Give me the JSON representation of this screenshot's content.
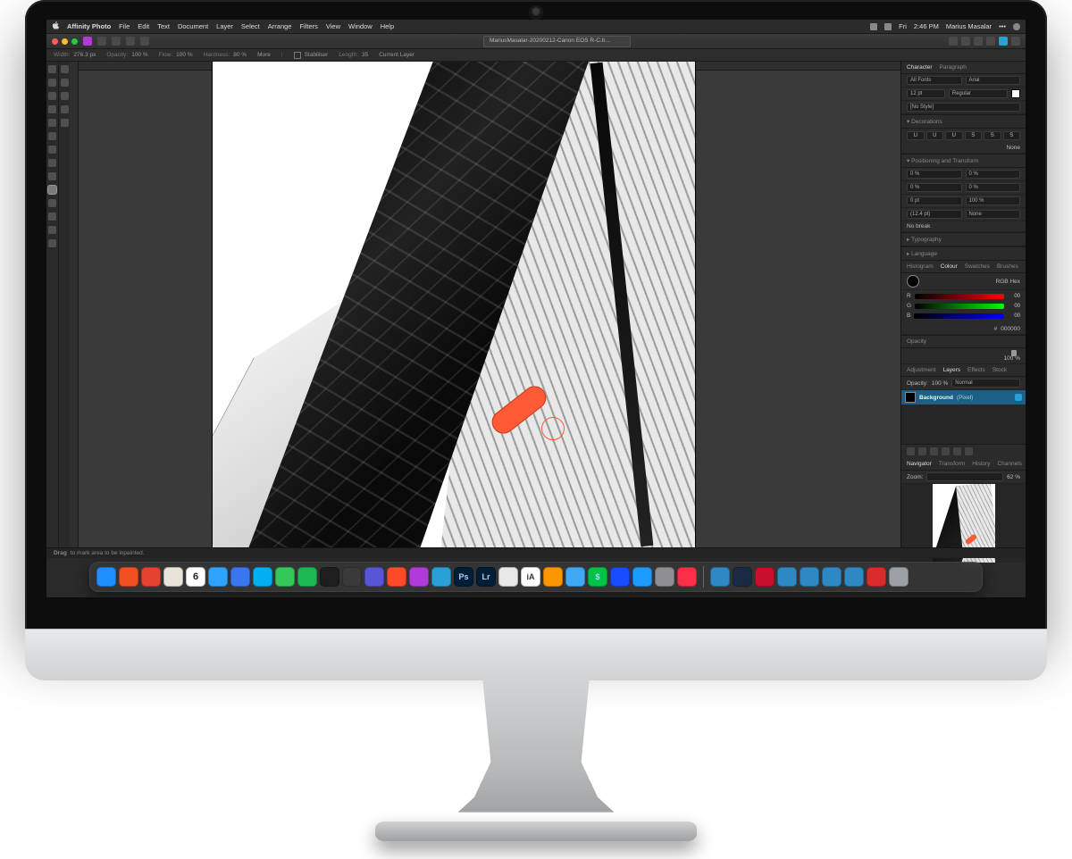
{
  "menubar": {
    "app": "Affinity Photo",
    "items": [
      "File",
      "Edit",
      "Text",
      "Document",
      "Layer",
      "Select",
      "Arrange",
      "Filters",
      "View",
      "Window",
      "Help"
    ],
    "right": {
      "day": "Fri",
      "time": "2:46 PM",
      "user": "Marius Masalar"
    }
  },
  "toolbar": {
    "fileTab": "MariusMasalar-20200212-Canon EOS R-C.ti…"
  },
  "contextbar": {
    "width_label": "Width:",
    "width": "276.3 px",
    "opacity_label": "Opacity:",
    "opacity": "100 %",
    "flow_label": "Flow:",
    "flow": "100 %",
    "hardness_label": "Hardness:",
    "hardness": "80 %",
    "more": "More",
    "stabiliser": "Stabiliser",
    "length_label": "Length:",
    "length": "35",
    "target": "Current Layer"
  },
  "status": {
    "hint_b": "Drag",
    "hint": "to mark area to be inpainted."
  },
  "panels": {
    "char": {
      "tabs": [
        "Character",
        "Paragraph"
      ],
      "fontGroup": "All Fonts",
      "font": "Arial",
      "size": "12 pt",
      "weight": "Regular",
      "style": "[No Style]"
    },
    "decor": {
      "title": "Decorations",
      "none": "None",
      "btns": [
        "U",
        "U",
        "U",
        "S",
        "S",
        "S"
      ]
    },
    "pos": {
      "title": "Positioning and Transform",
      "rows": [
        [
          "0 %",
          "0 %"
        ],
        [
          "0 %",
          "0 %"
        ],
        [
          "0 pt",
          "100 %"
        ],
        [
          "(12.4 pt)",
          "None"
        ]
      ],
      "nobreak": "No break"
    },
    "typo": "Typography",
    "lang": "Language",
    "colour": {
      "tabs": [
        "Histogram",
        "Colour",
        "Swatches",
        "Brushes"
      ],
      "mode": "RGB Hex",
      "r": "00",
      "g": "00",
      "b": "00",
      "hex": "000000"
    },
    "opacity": {
      "title": "Opacity",
      "value": "100 %"
    },
    "layers": {
      "tabs": [
        "Adjustment",
        "Layers",
        "Effects",
        "Stock"
      ],
      "opLabel": "Opacity:",
      "op": "100 %",
      "blend": "Normal",
      "items": [
        {
          "name": "Background",
          "kind": "(Pixel)"
        }
      ]
    },
    "nav": {
      "tabs": [
        "Navigator",
        "Transform",
        "History",
        "Channels"
      ],
      "zoomLabel": "Zoom:",
      "zoom": "62 %"
    }
  },
  "dock": {
    "apps": [
      {
        "n": "Finder",
        "c": "#1e90ff"
      },
      {
        "n": "Brave",
        "c": "#f25022"
      },
      {
        "n": "Todoist",
        "c": "#e44332"
      },
      {
        "n": "Slack",
        "c": "#e8e4dc"
      },
      {
        "n": "Calendar",
        "c": "#ffffff",
        "d": "6"
      },
      {
        "n": "Mail",
        "c": "#2ea3ff"
      },
      {
        "n": "Signal",
        "c": "#3a76f0"
      },
      {
        "n": "Skype",
        "c": "#00aff0"
      },
      {
        "n": "Messages",
        "c": "#34c759"
      },
      {
        "n": "Spotify",
        "c": "#1db954"
      },
      {
        "n": "Figma",
        "c": "#1e1e1e"
      },
      {
        "n": "DaVinci",
        "c": "#3a3a3a"
      },
      {
        "n": "iMovie",
        "c": "#5856d6"
      },
      {
        "n": "Affinity Publisher",
        "c": "#ff4a2a"
      },
      {
        "n": "Affinity Photo",
        "c": "#b13bd8"
      },
      {
        "n": "Affinity Designer",
        "c": "#2aa0d8"
      },
      {
        "n": "Photoshop",
        "c": "#001e36",
        "t": "Ps"
      },
      {
        "n": "Lightroom",
        "c": "#001e36",
        "t": "Lr"
      },
      {
        "n": "Safari",
        "c": "#e8e8e8"
      },
      {
        "n": "iA Writer",
        "c": "#ffffff",
        "t": "iA"
      },
      {
        "n": "Sublime",
        "c": "#ff9500"
      },
      {
        "n": "Things",
        "c": "#3fa9f5"
      },
      {
        "n": "Cash",
        "c": "#00c244",
        "t": "$"
      },
      {
        "n": "1Password",
        "c": "#1a4cff"
      },
      {
        "n": "App Store",
        "c": "#1e9bff"
      },
      {
        "n": "Settings",
        "c": "#8e8e93"
      },
      {
        "n": "Music",
        "c": "#fa2e47"
      }
    ],
    "right": [
      {
        "n": "Folder1",
        "c": "#2d88c3"
      },
      {
        "n": "IINA",
        "c": "#1b2a44"
      },
      {
        "n": "Video",
        "c": "#c8102e"
      },
      {
        "n": "FolderA",
        "c": "#2d88c3"
      },
      {
        "n": "FolderB",
        "c": "#2d88c3"
      },
      {
        "n": "FolderC",
        "c": "#2d88c3"
      },
      {
        "n": "FolderD",
        "c": "#2d88c3"
      },
      {
        "n": "PDF",
        "c": "#d92b2b"
      },
      {
        "n": "Trash",
        "c": "#9aa0a6"
      }
    ]
  }
}
